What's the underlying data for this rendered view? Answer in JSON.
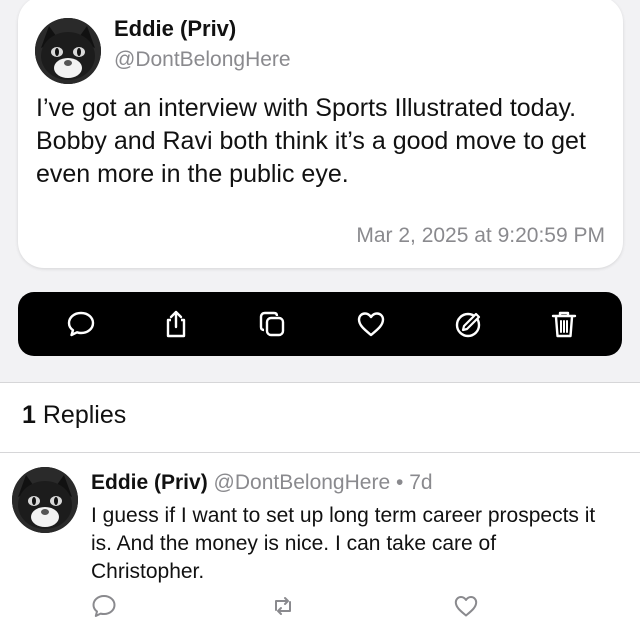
{
  "post": {
    "display_name": "Eddie (Priv)",
    "handle": "@DontBelongHere",
    "body": "I’ve got an interview with Sports Illustrated today. Bobby and Ravi both think it’s a good move to get even more in the public eye.",
    "timestamp": "Mar 2, 2025 at 9:20:59 PM",
    "avatar_icon": "tuxedo-cat-avatar"
  },
  "action_bar": {
    "icons": [
      "comment-icon",
      "share-icon",
      "copy-icon",
      "like-icon",
      "edit-icon",
      "delete-icon"
    ]
  },
  "replies": {
    "count": "1",
    "label": "Replies",
    "items": [
      {
        "display_name": "Eddie (Priv)",
        "handle": "@DontBelongHere",
        "separator": "•",
        "age": "7d",
        "body": "I guess if I want to set up long term career prospects it is. And the money is nice. I can take care of Christopher.",
        "actions": [
          "reply-icon",
          "repost-icon",
          "like-icon"
        ]
      }
    ]
  },
  "colors": {
    "background": "#ffffff",
    "top_background": "#f2f2f4",
    "action_bar": "#000000",
    "secondary_text": "#8a8a8e"
  }
}
